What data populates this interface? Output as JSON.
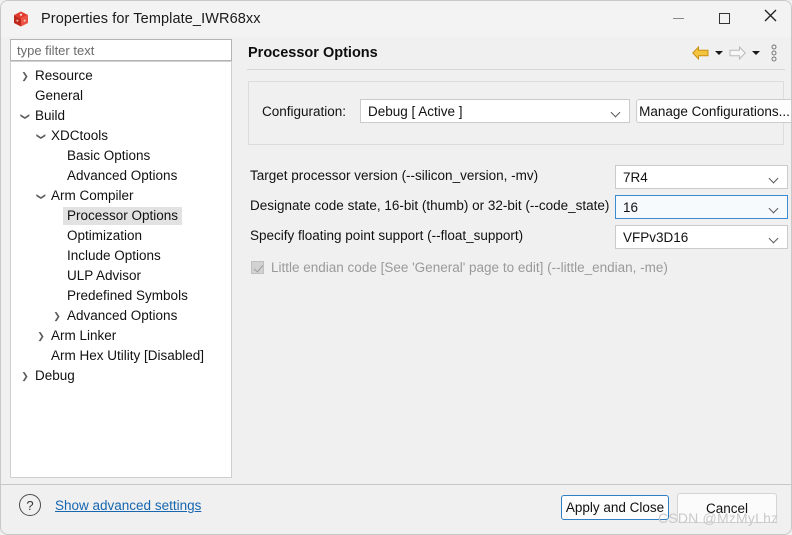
{
  "window": {
    "title": "Properties for Template_IWR68xx",
    "app_icon": "red-cube-icon",
    "controls": {
      "minimize": "minimize-icon",
      "maximize": "maximize-icon",
      "close": "close-icon"
    }
  },
  "filter": {
    "placeholder": "type filter text",
    "value": ""
  },
  "tree": {
    "items": [
      {
        "label": "Resource",
        "indent": 0,
        "twisty": "collapsed",
        "selected": false
      },
      {
        "label": "General",
        "indent": 0,
        "twisty": "none",
        "selected": false
      },
      {
        "label": "Build",
        "indent": 0,
        "twisty": "expanded",
        "selected": false
      },
      {
        "label": "XDCtools",
        "indent": 1,
        "twisty": "expanded",
        "selected": false
      },
      {
        "label": "Basic Options",
        "indent": 2,
        "twisty": "none",
        "selected": false
      },
      {
        "label": "Advanced Options",
        "indent": 2,
        "twisty": "none",
        "selected": false
      },
      {
        "label": "Arm Compiler",
        "indent": 1,
        "twisty": "expanded",
        "selected": false
      },
      {
        "label": "Processor Options",
        "indent": 2,
        "twisty": "none",
        "selected": true
      },
      {
        "label": "Optimization",
        "indent": 2,
        "twisty": "none",
        "selected": false
      },
      {
        "label": "Include Options",
        "indent": 2,
        "twisty": "none",
        "selected": false
      },
      {
        "label": "ULP Advisor",
        "indent": 2,
        "twisty": "none",
        "selected": false
      },
      {
        "label": "Predefined Symbols",
        "indent": 2,
        "twisty": "none",
        "selected": false
      },
      {
        "label": "Advanced Options",
        "indent": 2,
        "twisty": "collapsed",
        "selected": false
      },
      {
        "label": "Arm Linker",
        "indent": 1,
        "twisty": "collapsed",
        "selected": false
      },
      {
        "label": "Arm Hex Utility  [Disabled]",
        "indent": 1,
        "twisty": "none",
        "selected": false
      },
      {
        "label": "Debug",
        "indent": 0,
        "twisty": "collapsed",
        "selected": false
      }
    ]
  },
  "page": {
    "title": "Processor Options",
    "toolbar": {
      "back": "back-arrow-icon",
      "back_menu": "chevron-down-icon",
      "forward": "forward-arrow-icon",
      "forward_menu": "chevron-down-icon",
      "overflow": "vertical-dots-icon"
    },
    "configuration": {
      "label": "Configuration:",
      "value": "Debug  [ Active ]",
      "manage_button": "Manage Configurations..."
    },
    "options": [
      {
        "label": "Target processor version (--silicon_version, -mv)",
        "value": "7R4",
        "focused": false
      },
      {
        "label": "Designate code state, 16-bit (thumb) or 32-bit (--code_state)",
        "value": "16",
        "focused": true
      },
      {
        "label": "Specify floating point support (--float_support)",
        "value": "VFPv3D16",
        "focused": false
      }
    ],
    "endian": {
      "label": "Little endian code [See 'General' page to edit] (--little_endian, -me)",
      "checked": true,
      "enabled": false
    }
  },
  "footer": {
    "help_icon": "question-mark-icon",
    "advanced_link": "Show advanced settings",
    "apply_button": "Apply and Close",
    "cancel_button": "Cancel",
    "watermark": "CSDN @MzMyLhz"
  },
  "colors": {
    "accent_blue": "#2e7fc4",
    "link_blue": "#1666b0",
    "back_arrow_gold": "#e8a317",
    "window_bg": "#f0f0f0",
    "selection_gray": "#e2e2e2"
  }
}
